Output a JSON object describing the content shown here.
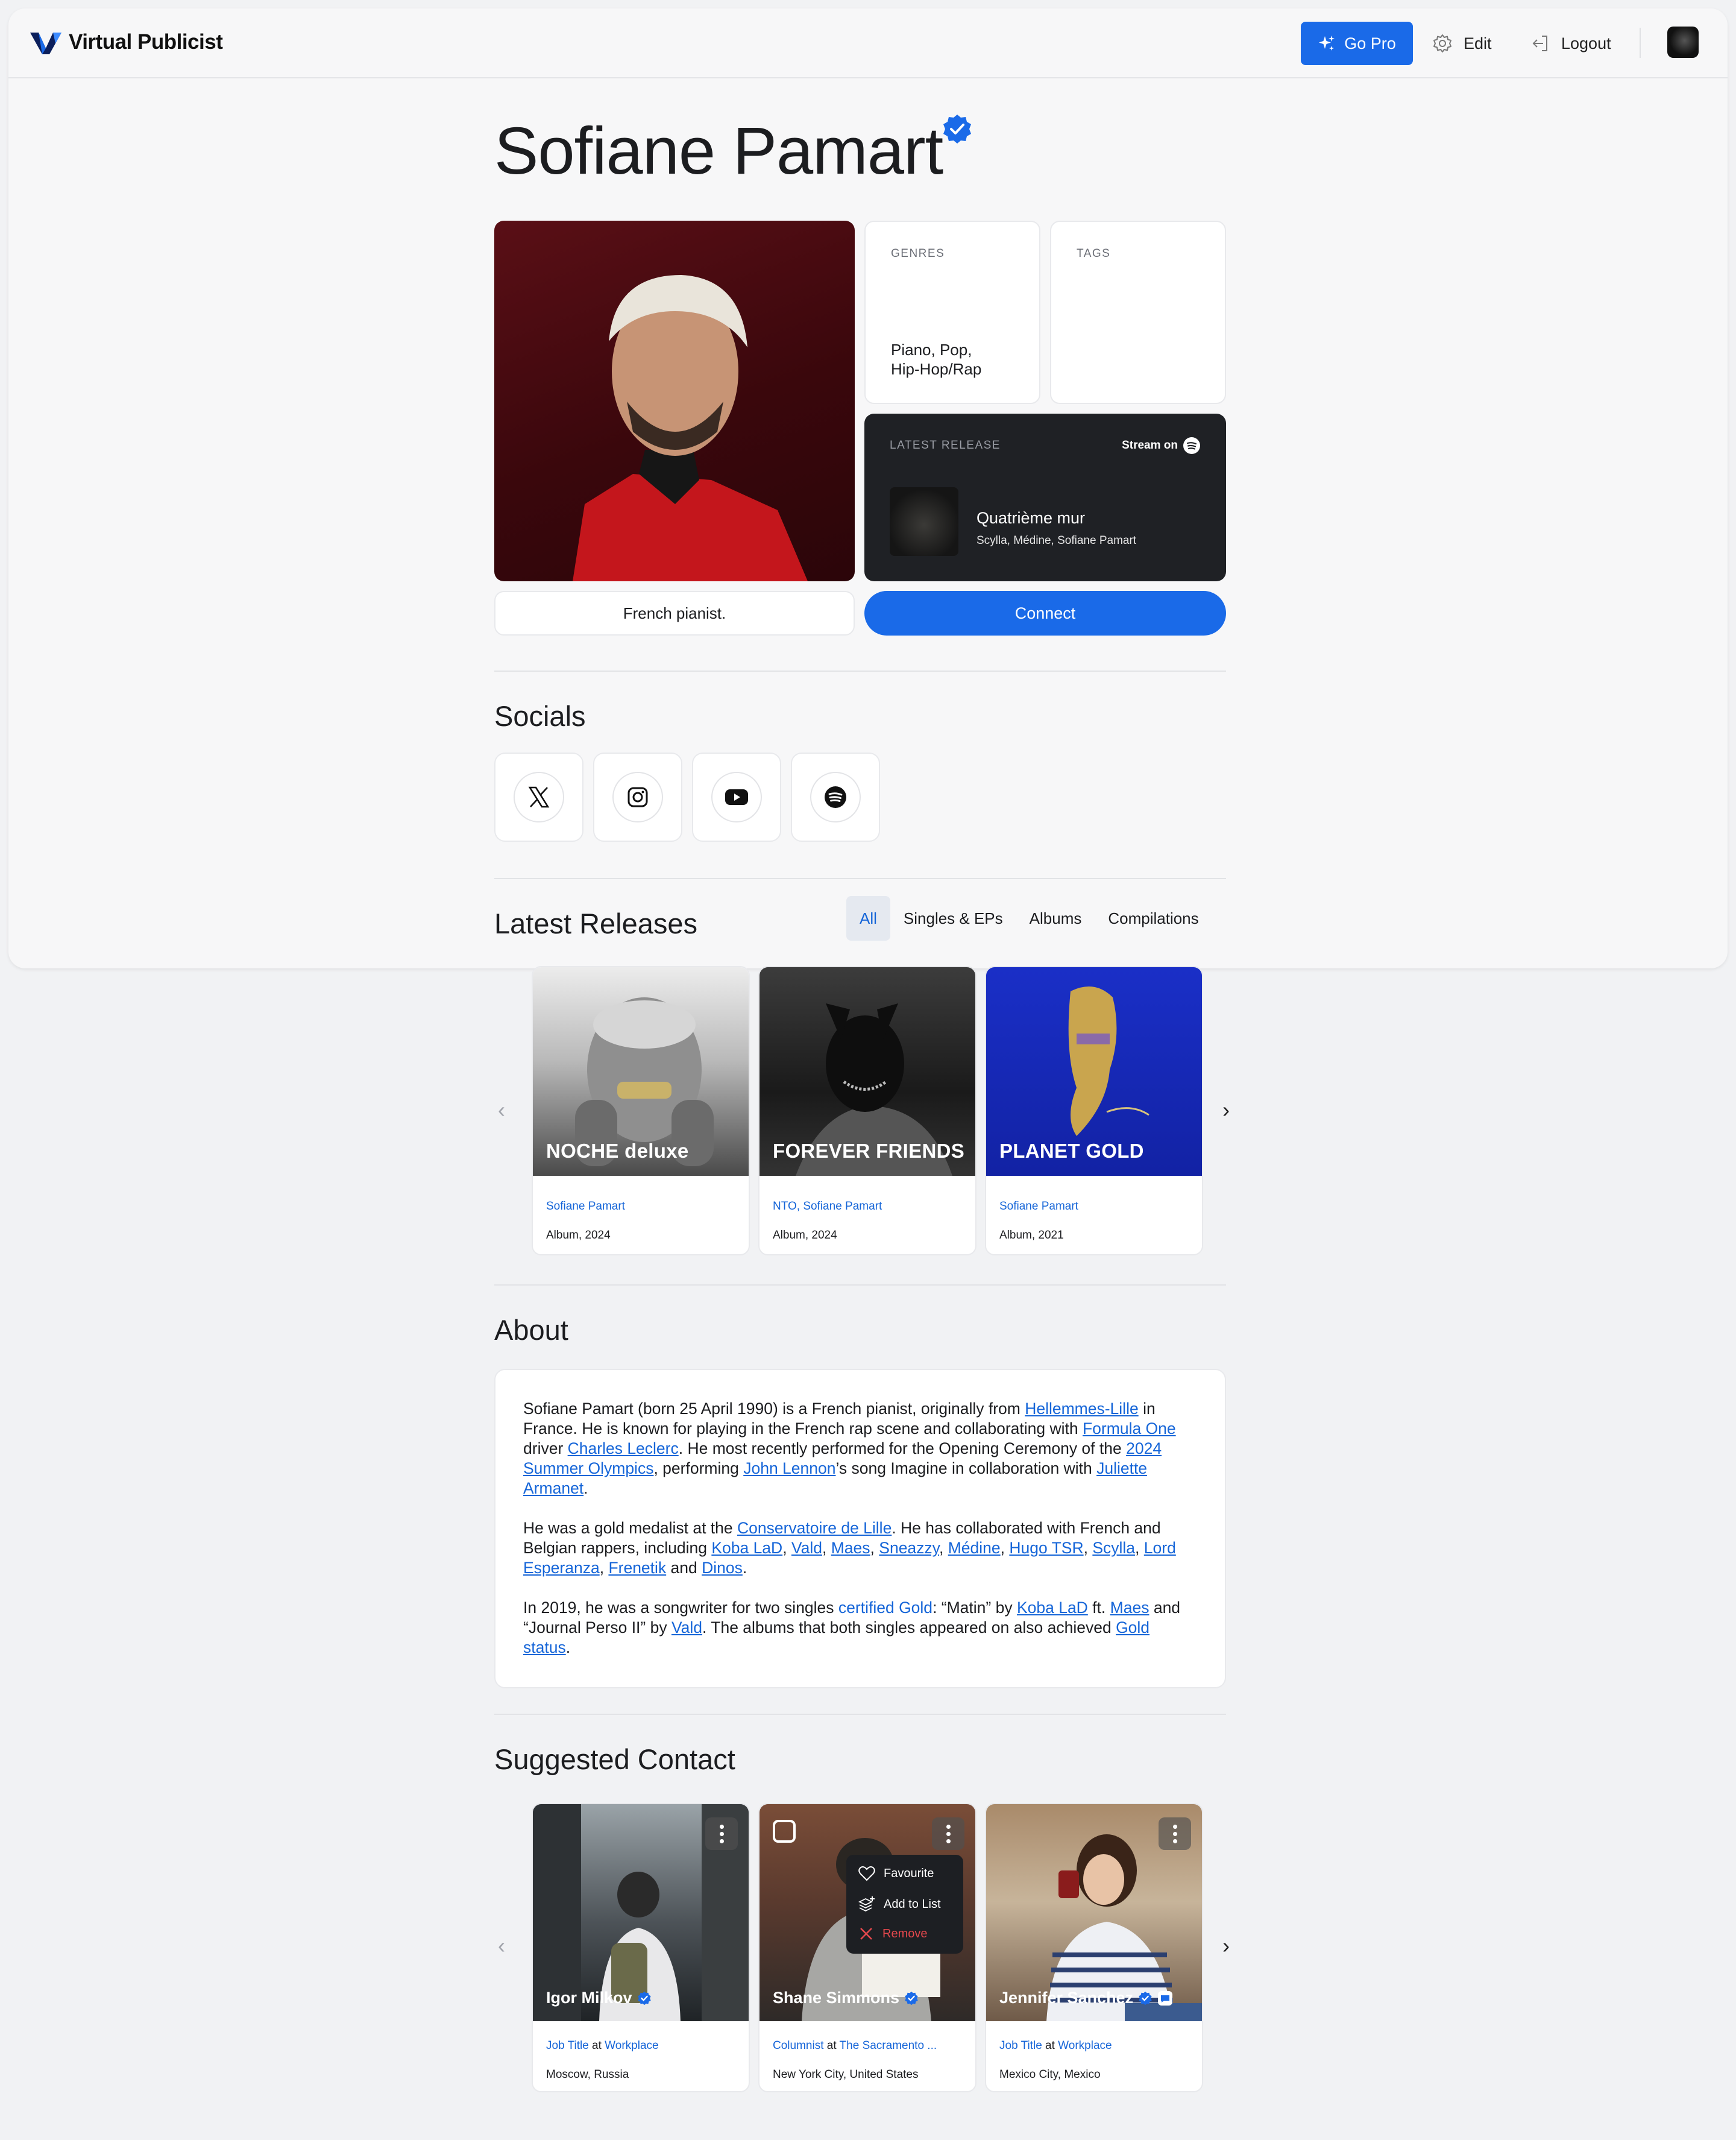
{
  "header": {
    "brand": "Virtual Publicist",
    "go_pro": "Go Pro",
    "edit": "Edit",
    "logout": "Logout"
  },
  "artist": {
    "name": "Sofiane Pamart",
    "genres_label": "GENRES",
    "genres_line1": "Piano, Pop,",
    "genres_line2": "Hip-Hop/Rap",
    "tags_label": "TAGS",
    "tagline": "French pianist.",
    "connect": "Connect"
  },
  "latest_release": {
    "label": "LATEST RELEASE",
    "stream_on": "Stream on",
    "title": "Quatrième mur",
    "artists": "Scylla, Médine, Sofiane Pamart"
  },
  "socials": {
    "title": "Socials",
    "items": [
      "x-icon",
      "instagram-icon",
      "youtube-icon",
      "spotify-icon"
    ]
  },
  "releases": {
    "title": "Latest Releases",
    "tabs": [
      "All",
      "Singles & EPs",
      "Albums",
      "Compilations"
    ],
    "active_tab": "All",
    "items": [
      {
        "title": "NOCHE deluxe",
        "artist": "Sofiane Pamart",
        "meta": "Album, 2024"
      },
      {
        "title": "FOREVER FRIENDS",
        "artist": "NTO, Sofiane Pamart",
        "meta": "Album, 2024"
      },
      {
        "title": "PLANET GOLD",
        "artist": "Sofiane Pamart",
        "meta": "Album, 2021"
      }
    ]
  },
  "about": {
    "title": "About",
    "p1": [
      "Sofiane Pamart (born 25 April 1990) is a French pianist, originally from ",
      "Hellemmes-Lille",
      " in France. He is known for playing in the French rap scene and collaborating with ",
      "Formula One",
      " driver ",
      "Charles Leclerc",
      ". He most recently performed for the Opening Ceremony of the ",
      "2024 Summer Olympics",
      ", performing ",
      "John Lennon",
      "’s song Imagine in collaboration with ",
      "Juliette Armanet",
      "."
    ],
    "p2": [
      "He was a gold medalist at the ",
      "Conservatoire de Lille",
      ". He has collaborated with French and Belgian rappers, including ",
      "Koba LaD",
      ", ",
      "Vald",
      ", ",
      "Maes",
      ", ",
      "Sneazzy",
      ", ",
      "Médine",
      ", ",
      "Hugo TSR",
      ", ",
      "Scylla",
      ", ",
      "Lord Esperanza",
      ", ",
      "Frenetik",
      " and ",
      "Dinos",
      "."
    ],
    "p3": [
      "In 2019, he was a songwriter for two singles ",
      "certified Gold",
      ": “Matin” by ",
      "Koba LaD",
      " ft. ",
      "Maes",
      " and “Journal Perso II” by ",
      "Vald",
      ". The albums that both singles appeared on also achieved ",
      "Gold status",
      "."
    ]
  },
  "contacts": {
    "title": "Suggested Contact",
    "items": [
      {
        "name": "Igor Milkov",
        "job": "Job Title",
        "at": " at ",
        "workplace": "Workplace",
        "location": "Moscow, Russia"
      },
      {
        "name": "Shane Simmons",
        "job": "Columnist",
        "at": " at ",
        "workplace": "The Sacramento ...",
        "location": "New York City, United States"
      },
      {
        "name": "Jennifer Sanchez",
        "job": "Job Title",
        "at": " at ",
        "workplace": "Workplace",
        "location": "Mexico City, Mexico"
      }
    ],
    "menu": {
      "favourite": "Favourite",
      "add_to_list": "Add to List",
      "remove": "Remove"
    }
  },
  "colors": {
    "accent": "#1a6ae8",
    "link": "#1565d8",
    "remove": "#e5484d"
  }
}
